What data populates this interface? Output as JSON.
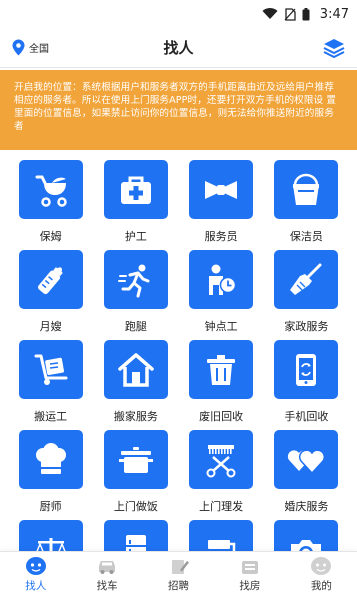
{
  "status": {
    "time": "3:47"
  },
  "header": {
    "location": "全国",
    "title": "找人"
  },
  "notice": {
    "text": "开启我的位置：系统根据用户和服务者双方的手机距离由近及远给用户推荐 相应的服务者。所以在使用上门服务APP时，还要打开双方手机的权限设 置里面的位置信息，如果禁止访问你的位置信息，则无法给你推送附近的服务者"
  },
  "grid": [
    {
      "label": "保姆",
      "icon": "stroller-icon"
    },
    {
      "label": "护工",
      "icon": "medical-kit-icon"
    },
    {
      "label": "服务员",
      "icon": "bow-tie-icon"
    },
    {
      "label": "保洁员",
      "icon": "bucket-icon"
    },
    {
      "label": "月嫂",
      "icon": "baby-bottle-icon"
    },
    {
      "label": "跑腿",
      "icon": "runner-icon"
    },
    {
      "label": "钟点工",
      "icon": "hourly-worker-icon"
    },
    {
      "label": "家政服务",
      "icon": "broom-icon"
    },
    {
      "label": "搬运工",
      "icon": "hand-truck-icon"
    },
    {
      "label": "搬家服务",
      "icon": "house-icon"
    },
    {
      "label": "废旧回收",
      "icon": "trash-can-icon"
    },
    {
      "label": "手机回收",
      "icon": "phone-recycle-icon"
    },
    {
      "label": "厨师",
      "icon": "chef-hat-icon"
    },
    {
      "label": "上门做饭",
      "icon": "cooking-pot-icon"
    },
    {
      "label": "上门理发",
      "icon": "scissors-comb-icon"
    },
    {
      "label": "婚庆服务",
      "icon": "hearts-icon"
    },
    {
      "label": "",
      "icon": "scales-icon"
    },
    {
      "label": "",
      "icon": "fridge-icon"
    },
    {
      "label": "",
      "icon": "brush-icon"
    },
    {
      "label": "",
      "icon": "camera-icon"
    }
  ],
  "tabs": [
    {
      "label": "找人",
      "icon": "person-icon",
      "active": true
    },
    {
      "label": "找车",
      "icon": "car-icon",
      "active": false
    },
    {
      "label": "招聘",
      "icon": "pen-icon",
      "active": false
    },
    {
      "label": "找房",
      "icon": "house-tab-icon",
      "active": false
    },
    {
      "label": "我的",
      "icon": "profile-icon",
      "active": false
    }
  ],
  "colors": {
    "accent": "#1f72f2",
    "notice_bg": "#f1a43a"
  }
}
